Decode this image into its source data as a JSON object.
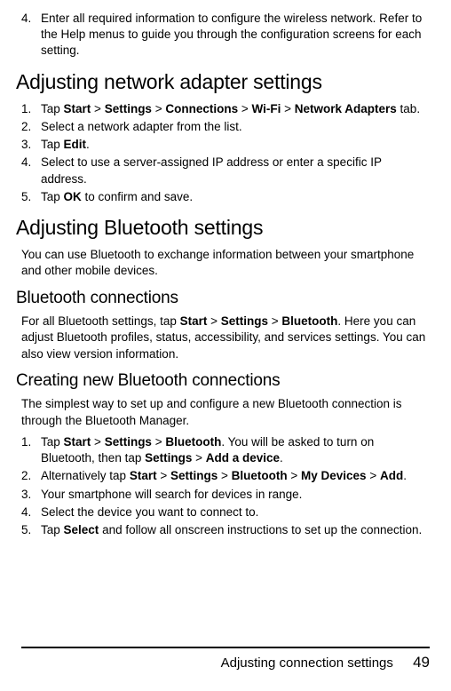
{
  "top_list": [
    {
      "num": "4.",
      "parts": [
        "Enter all required information to configure the wireless network. Refer to the Help menus to guide you through the configuration screens for each setting."
      ]
    }
  ],
  "s1": {
    "title": "Adjusting network adapter settings",
    "items": [
      {
        "num": "1.",
        "parts": [
          "Tap ",
          "Start",
          " > ",
          "Settings",
          " > ",
          "Connections",
          " > ",
          "Wi-Fi",
          " > ",
          "Network Adapters",
          " tab."
        ]
      },
      {
        "num": "2.",
        "parts": [
          "Select a network adapter from the list."
        ]
      },
      {
        "num": "3.",
        "parts": [
          "Tap ",
          "Edit",
          "."
        ]
      },
      {
        "num": "4.",
        "parts": [
          "Select to use a server-assigned IP address or enter a specific IP address."
        ]
      },
      {
        "num": "5.",
        "parts": [
          "Tap ",
          "OK",
          " to confirm and save."
        ]
      }
    ]
  },
  "s2": {
    "title": "Adjusting Bluetooth settings",
    "intro": "You can use Bluetooth to exchange information between your smartphone and other mobile devices."
  },
  "s3": {
    "title": "Bluetooth connections",
    "body": {
      "parts": [
        "For all Bluetooth settings, tap ",
        "Start",
        " > ",
        "Settings",
        " > ",
        "Bluetooth",
        ". Here you can adjust Bluetooth profiles, status, accessibility, and services settings. You can also view version information."
      ]
    }
  },
  "s4": {
    "title": "Creating new Bluetooth connections",
    "intro": "The simplest way to set up and configure a new Bluetooth connection is through the Bluetooth Manager.",
    "items": [
      {
        "num": "1.",
        "parts": [
          "Tap ",
          "Start",
          " > ",
          "Settings",
          " > ",
          "Bluetooth",
          ". You will be asked to turn on Bluetooth, then tap ",
          "Settings",
          " > ",
          "Add a device",
          "."
        ]
      },
      {
        "num": "2.",
        "parts": [
          "Alternatively tap ",
          "Start",
          " > ",
          "Settings",
          " > ",
          "Bluetooth",
          " > ",
          "My Devices",
          " > ",
          "Add",
          "."
        ]
      },
      {
        "num": "3.",
        "parts": [
          "Your smartphone will search for devices in range."
        ]
      },
      {
        "num": "4.",
        "parts": [
          "Select the device you want to connect to."
        ]
      },
      {
        "num": "5.",
        "parts": [
          "Tap ",
          "Select",
          " and follow all onscreen instructions to set up the connection."
        ]
      }
    ]
  },
  "footer": {
    "title": "Adjusting connection settings",
    "page": "49"
  }
}
